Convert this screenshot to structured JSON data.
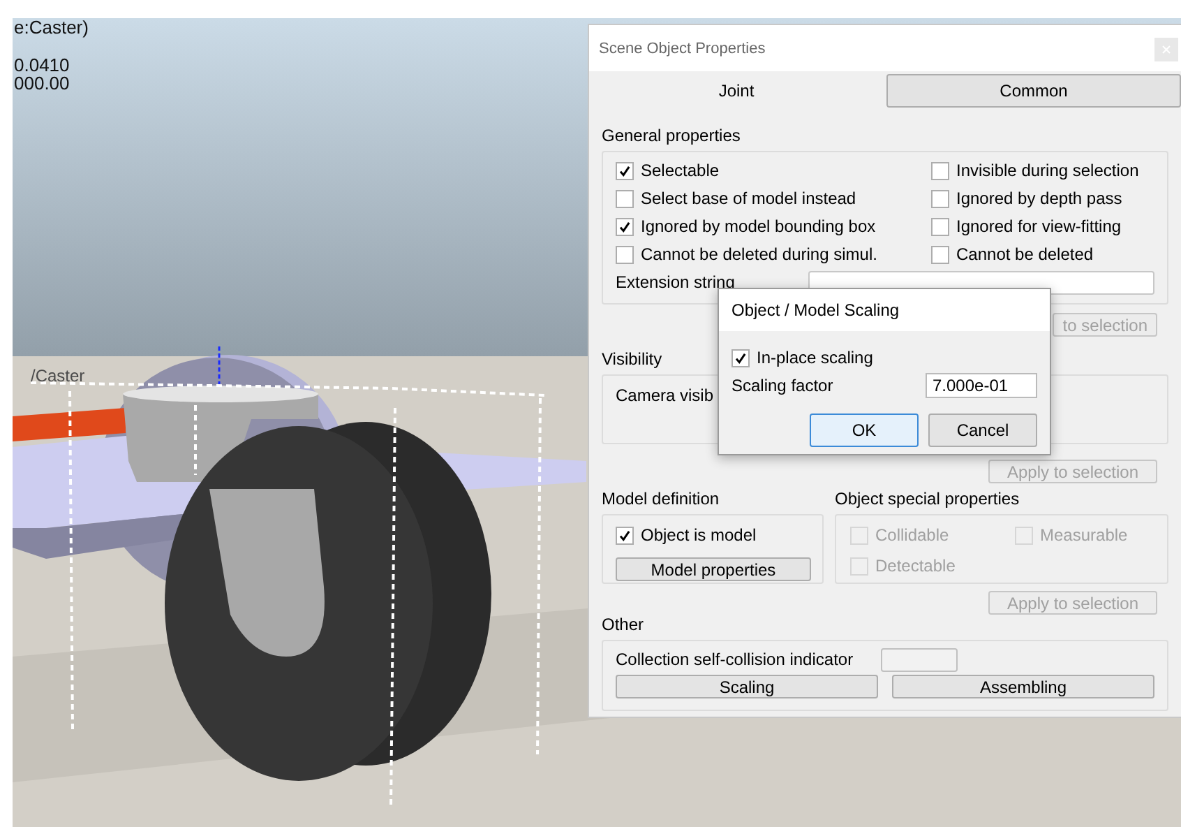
{
  "viewport": {
    "overlay_lines": [
      "e:Caster)",
      "0.0410",
      "000.00"
    ],
    "object_label": "/Caster"
  },
  "properties_window": {
    "title": "Scene Object Properties",
    "tabs": [
      {
        "label": "Joint",
        "selected": false
      },
      {
        "label": "Common",
        "selected": true
      }
    ],
    "general": {
      "title": "General properties",
      "checkboxes": [
        {
          "label": "Selectable",
          "checked": true
        },
        {
          "label": "Invisible during selection",
          "checked": false
        },
        {
          "label": "Select base of model instead",
          "checked": false
        },
        {
          "label": "Ignored by depth pass",
          "checked": false
        },
        {
          "label": "Ignored by model bounding  box",
          "checked": true
        },
        {
          "label": "Ignored for view-fitting",
          "checked": false
        },
        {
          "label": "Cannot be deleted during simul.",
          "checked": false
        },
        {
          "label": "Cannot be deleted",
          "checked": false
        }
      ],
      "extension_label": "Extension string",
      "apply_button": "to selection"
    },
    "visibility": {
      "title": "Visibility",
      "camera_label": "Camera visib",
      "apply_button": "Apply to selection"
    },
    "model_definition": {
      "title": "Model definition",
      "checkbox": {
        "label": "Object is model",
        "checked": true
      },
      "button": "Model properties"
    },
    "special": {
      "title": "Object special properties",
      "checkboxes": [
        {
          "label": "Collidable",
          "checked": false,
          "disabled": true
        },
        {
          "label": "Measurable",
          "checked": false,
          "disabled": true
        },
        {
          "label": "Detectable",
          "checked": false,
          "disabled": true
        }
      ],
      "apply_button": "Apply to selection"
    },
    "other": {
      "title": "Other",
      "indicator_label": "Collection self-collision indicator",
      "buttons": [
        "Scaling",
        "Assembling"
      ]
    }
  },
  "scaling_dialog": {
    "title": "Object / Model Scaling",
    "checkbox": {
      "label": "In-place scaling",
      "checked": true
    },
    "factor_label": "Scaling factor",
    "factor_value": "7.000e-01",
    "buttons": [
      {
        "label": "OK",
        "focused": true
      },
      {
        "label": "Cancel",
        "focused": false
      }
    ]
  }
}
